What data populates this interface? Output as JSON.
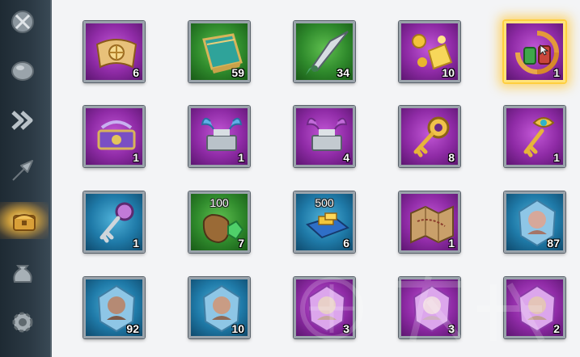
{
  "sidebar": {
    "items": [
      {
        "icon": "crossed-swords-icon",
        "active": false
      },
      {
        "icon": "stone-icon",
        "active": false
      },
      {
        "icon": "speedup-chevrons-icon",
        "active": false
      },
      {
        "icon": "upgrade-arrow-icon",
        "active": false
      },
      {
        "icon": "treasure-chest-icon",
        "active": true
      },
      {
        "icon": "resource-sack-icon",
        "active": false
      },
      {
        "icon": "gear-icon",
        "active": false
      }
    ]
  },
  "inventory": {
    "items": [
      {
        "name": "treasure-map-scroll",
        "rarity": "purple",
        "count": "6"
      },
      {
        "name": "green-tome",
        "rarity": "green",
        "count": "59"
      },
      {
        "name": "spear-arrow",
        "rarity": "green",
        "count": "34"
      },
      {
        "name": "gold-shards",
        "rarity": "purple",
        "count": "10"
      },
      {
        "name": "recycle-pack",
        "rarity": "purple",
        "count": "1",
        "selected": true
      },
      {
        "name": "purple-skill-book",
        "rarity": "purple",
        "count": "1"
      },
      {
        "name": "crystal-anvil",
        "rarity": "purple",
        "count": "1"
      },
      {
        "name": "purple-anvil",
        "rarity": "purple",
        "count": "4"
      },
      {
        "name": "golden-star-key",
        "rarity": "purple",
        "count": "8"
      },
      {
        "name": "golden-gem-key",
        "rarity": "purple",
        "count": "1"
      },
      {
        "name": "silver-key",
        "rarity": "blue",
        "count": "1"
      },
      {
        "name": "gem-sack",
        "rarity": "green",
        "amount": "100",
        "count": "7"
      },
      {
        "name": "gold-book",
        "rarity": "blue",
        "amount": "500",
        "count": "6"
      },
      {
        "name": "old-map",
        "rarity": "purple",
        "count": "1"
      },
      {
        "name": "commander-sculpture-blue",
        "rarity": "blue",
        "count": "87"
      },
      {
        "name": "commander-sculpture-blue",
        "rarity": "blue",
        "count": "92"
      },
      {
        "name": "commander-sculpture-blue",
        "rarity": "blue",
        "count": "10"
      },
      {
        "name": "commander-sculpture-purple",
        "rarity": "purple",
        "count": "3"
      },
      {
        "name": "commander-sculpture-purple",
        "rarity": "purple",
        "count": "3"
      },
      {
        "name": "commander-sculpture-purple",
        "rarity": "purple",
        "count": "2"
      }
    ]
  },
  "colors": {
    "purple": "#8f2ba6",
    "green": "#2f8a2c",
    "blue": "#1f7aa8",
    "selection_glow": "#ffcf3f",
    "sidebar_bg": "#2b3944"
  }
}
